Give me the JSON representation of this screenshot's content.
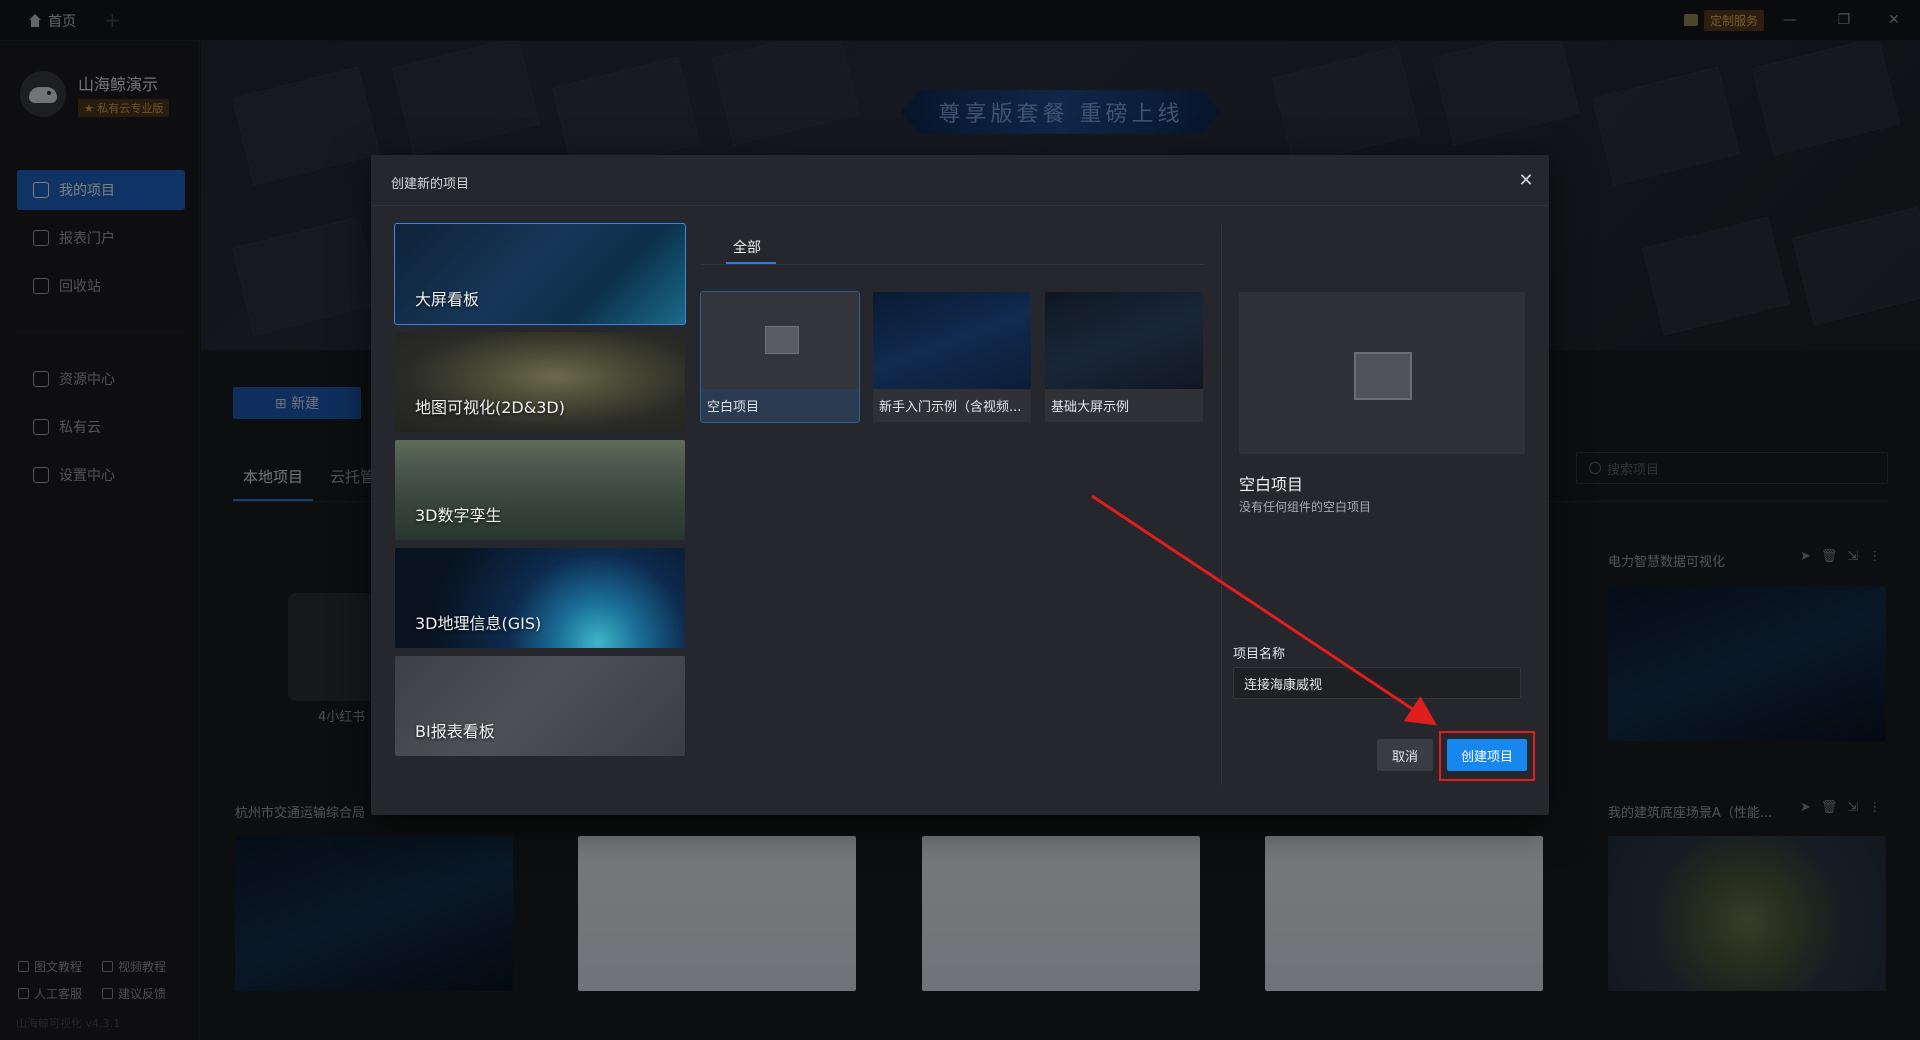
{
  "titlebar": {
    "home_tab": "首页",
    "add_tab": "+",
    "custom_service": "定制服务",
    "minimize": "—",
    "restore": "❐",
    "close": "✕"
  },
  "sidebar": {
    "app_name": "山海鲸演示",
    "plan": "★ 私有云专业版",
    "nav": [
      {
        "label": "我的项目",
        "icon": "monitor-icon",
        "active": true
      },
      {
        "label": "报表门户",
        "icon": "chart-icon",
        "active": false
      },
      {
        "label": "回收站",
        "icon": "trash-icon",
        "active": false
      },
      {
        "label": "资源中心",
        "icon": "cube-icon",
        "active": false
      },
      {
        "label": "私有云",
        "icon": "cloud-icon",
        "active": false
      },
      {
        "label": "设置中心",
        "icon": "gear-icon",
        "active": false
      }
    ],
    "footer": [
      "图文教程",
      "视频教程",
      "人工客服",
      "建议反馈"
    ],
    "version": "山海鲸可视化 v4.3.1"
  },
  "main": {
    "banner_title": "尊享版套餐 重磅上线",
    "new_button": "⊞ 新建",
    "tabs": [
      "本地项目",
      "云托管"
    ],
    "search_placeholder": "搜索项目",
    "folder_label": "4小红书",
    "cards": [
      {
        "title": "杭州市交通运输综合局"
      },
      {
        "title": "电力智慧数据可视化"
      },
      {
        "title": "我的建筑底座场景A（性能..."
      }
    ]
  },
  "modal": {
    "title": "创建新的项目",
    "close": "✕",
    "categories": [
      "大屏看板",
      "地图可视化(2D&3D)",
      "3D数字孪生",
      "3D地理信息(GIS)",
      "BI报表看板"
    ],
    "template_tab": "全部",
    "templates": [
      "空白项目",
      "新手入门示例（含视频...",
      "基础大屏示例"
    ],
    "preview_title": "空白项目",
    "preview_desc": "没有任何组件的空白项目",
    "name_label": "项目名称",
    "name_value": "连接海康威视",
    "cancel": "取消",
    "create": "创建项目"
  },
  "colors": {
    "accent": "#1787f0",
    "sidebar_active": "#1c66c8",
    "annotation": "#e01e1e"
  }
}
